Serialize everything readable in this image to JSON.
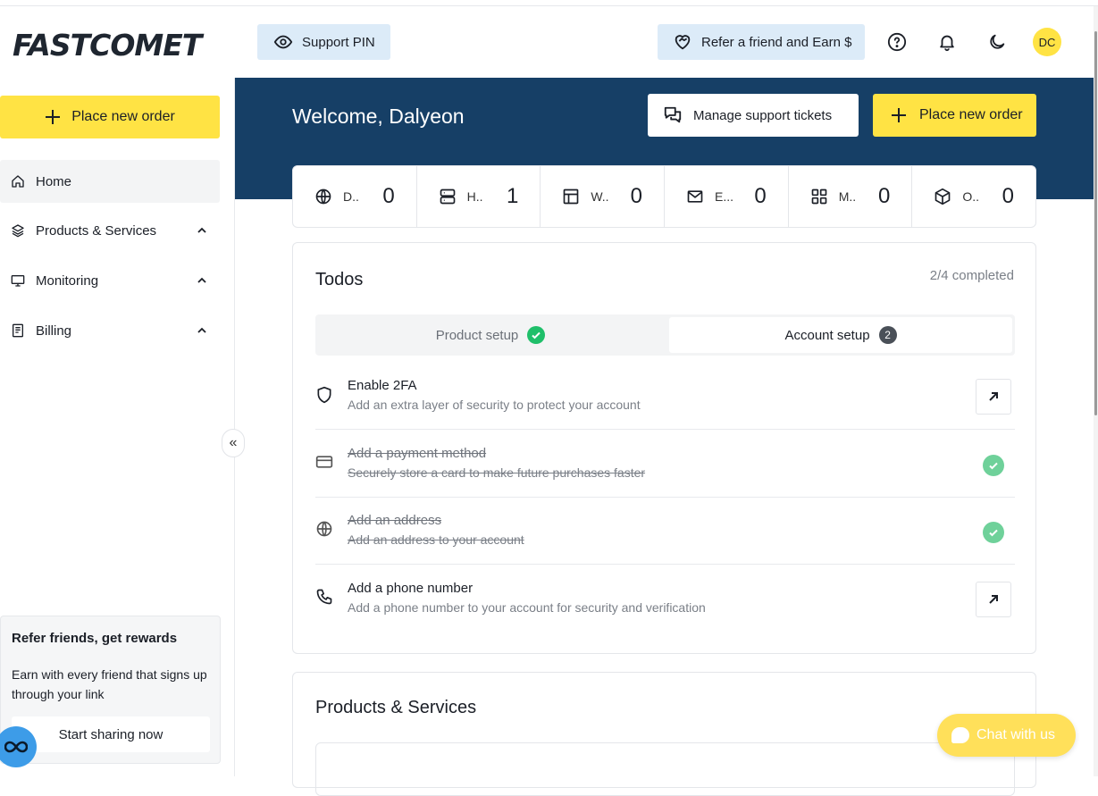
{
  "brand": {
    "logo_text": "FASTCOMET"
  },
  "header": {
    "support_pin_label": "Support PIN",
    "refer_label": "Refer a friend and Earn $",
    "avatar_initials": "DC"
  },
  "sidebar": {
    "place_order_label": "Place new order",
    "items": [
      {
        "label": "Home"
      },
      {
        "label": "Products & Services"
      },
      {
        "label": "Monitoring"
      },
      {
        "label": "Billing"
      }
    ],
    "collapse_glyph": "«",
    "refer_card": {
      "title": "Refer friends, get rewards",
      "text": "Earn with every friend that signs up through your link",
      "button": "Start sharing now"
    }
  },
  "banner": {
    "welcome": "Welcome, Dalyeon",
    "tickets_label": "Manage support tickets",
    "place_order_label": "Place new order"
  },
  "stats": [
    {
      "label": "D..",
      "value": "0",
      "icon": "globe-icon"
    },
    {
      "label": "H..",
      "value": "1",
      "icon": "server-icon"
    },
    {
      "label": "W..",
      "value": "0",
      "icon": "layout-icon"
    },
    {
      "label": "E...",
      "value": "0",
      "icon": "mail-icon"
    },
    {
      "label": "M..",
      "value": "0",
      "icon": "grid-icon"
    },
    {
      "label": "O..",
      "value": "0",
      "icon": "box-icon"
    }
  ],
  "todos": {
    "title": "Todos",
    "completed": "2/4 completed",
    "tabs": [
      {
        "label": "Product setup"
      },
      {
        "label": "Account setup",
        "badge": "2"
      }
    ],
    "tasks": [
      {
        "title": "Enable 2FA",
        "desc": "Add an extra layer of security to protect your account"
      },
      {
        "title": "Add a payment method",
        "desc": "Securely store a card to make future purchases faster"
      },
      {
        "title": "Add an address",
        "desc": "Add an address to your account"
      },
      {
        "title": "Add a phone number",
        "desc": "Add a phone number to your account for security and verification"
      }
    ]
  },
  "products": {
    "title": "Products & Services"
  },
  "chat": {
    "label": "Chat with us"
  },
  "colors": {
    "accent_yellow": "#ffe344",
    "banner_navy": "#163f66",
    "success_green": "#1fbf6a"
  }
}
